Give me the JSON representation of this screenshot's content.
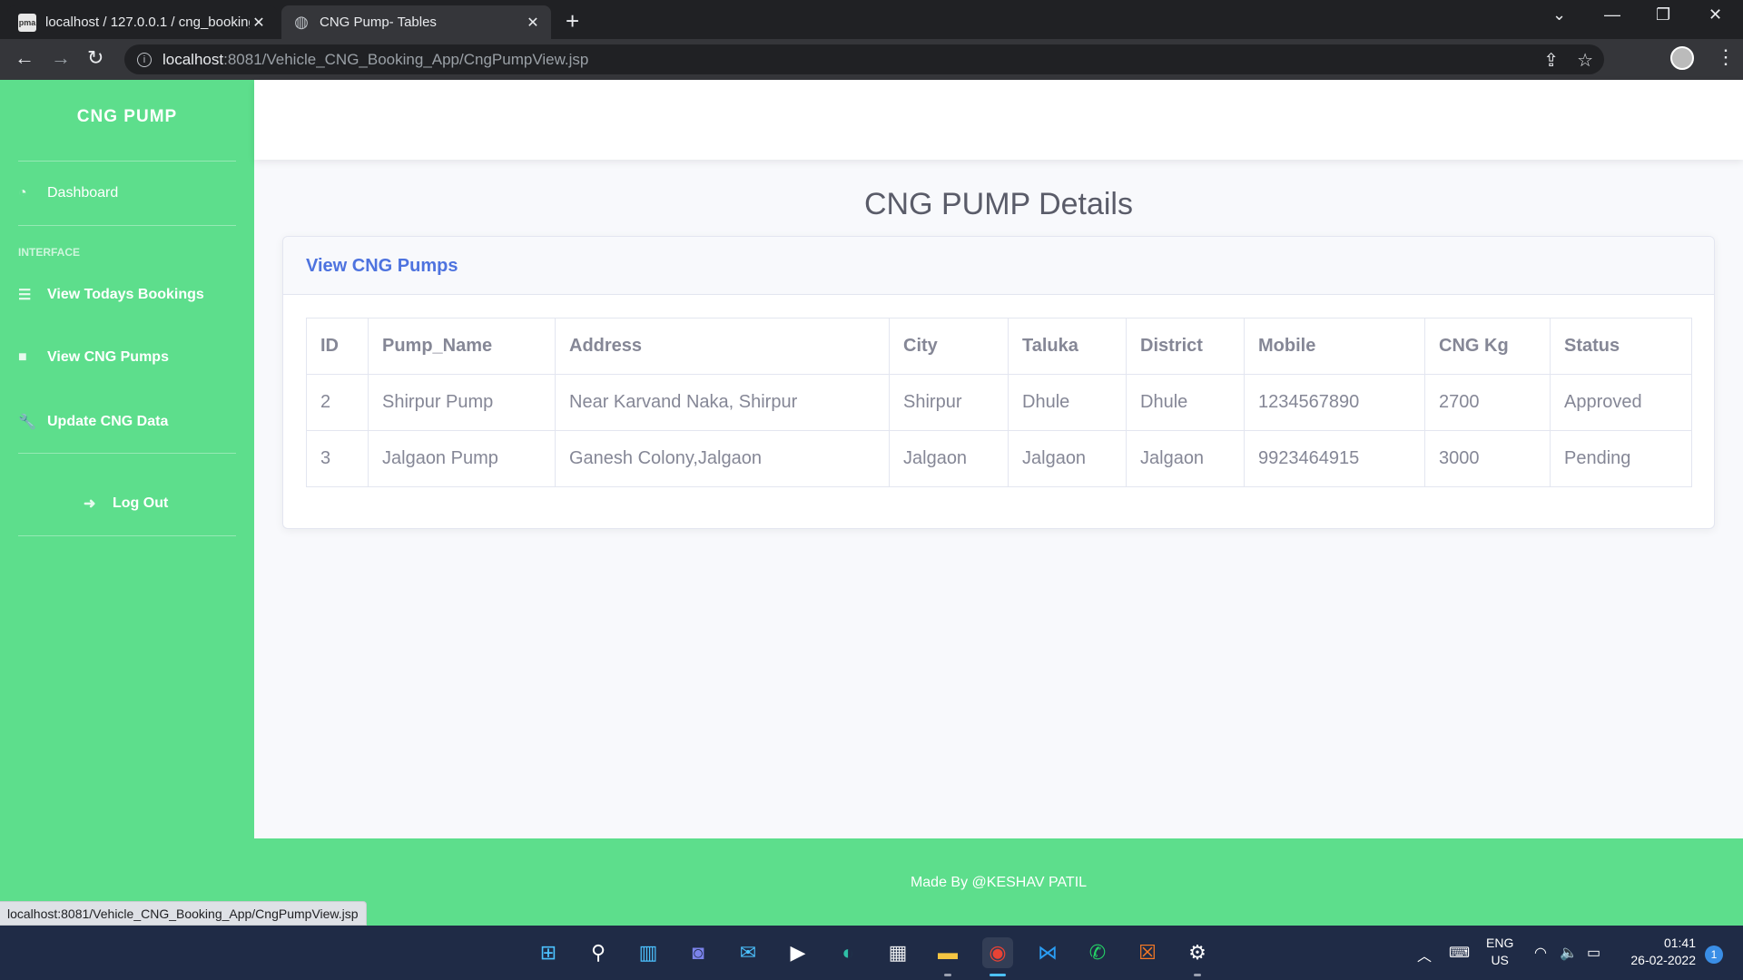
{
  "browser": {
    "tabs": [
      {
        "title": "localhost / 127.0.0.1 / cng_booking",
        "favicon": "phpmyadmin-icon",
        "active": false
      },
      {
        "title": "CNG Pump- Tables",
        "favicon": "globe-icon",
        "active": true
      }
    ],
    "url_host": "localhost",
    "url_rest": ":8081/Vehicle_CNG_Booking_App/CngPumpView.jsp",
    "status_url": "localhost:8081/Vehicle_CNG_Booking_App/CngPumpView.jsp"
  },
  "sidebar": {
    "brand": "CNG PUMP",
    "dashboard": "Dashboard",
    "heading": "INTERFACE",
    "items": [
      {
        "label": "View Todays Bookings",
        "icon": "list-icon"
      },
      {
        "label": "View CNG Pumps",
        "icon": "folder-icon"
      },
      {
        "label": "Update CNG Data",
        "icon": "wrench-icon"
      }
    ],
    "logout": "Log Out"
  },
  "main": {
    "page_title": "CNG PUMP Details",
    "card_title": "View CNG Pumps",
    "table": {
      "columns": [
        "ID",
        "Pump_Name",
        "Address",
        "City",
        "Taluka",
        "District",
        "Mobile",
        "CNG Kg",
        "Status"
      ],
      "rows": [
        [
          "2",
          "Shirpur Pump",
          "Near Karvand Naka, Shirpur",
          "Shirpur",
          "Dhule",
          "Dhule",
          "1234567890",
          "2700",
          "Approved"
        ],
        [
          "3",
          "Jalgaon Pump",
          "Ganesh Colony,Jalgaon",
          "Jalgaon",
          "Jalgaon",
          "Jalgaon",
          "9923464915",
          "3000",
          "Pending"
        ]
      ]
    }
  },
  "footer": {
    "text": "Made By @KESHAV PATIL"
  },
  "taskbar": {
    "lang_1": "ENG",
    "lang_2": "US",
    "time": "01:41",
    "date": "26-02-2022",
    "notifications": "1"
  },
  "colors": {
    "sidebar": "#5dde8c",
    "accent": "#4e73df",
    "text": "#858796"
  }
}
